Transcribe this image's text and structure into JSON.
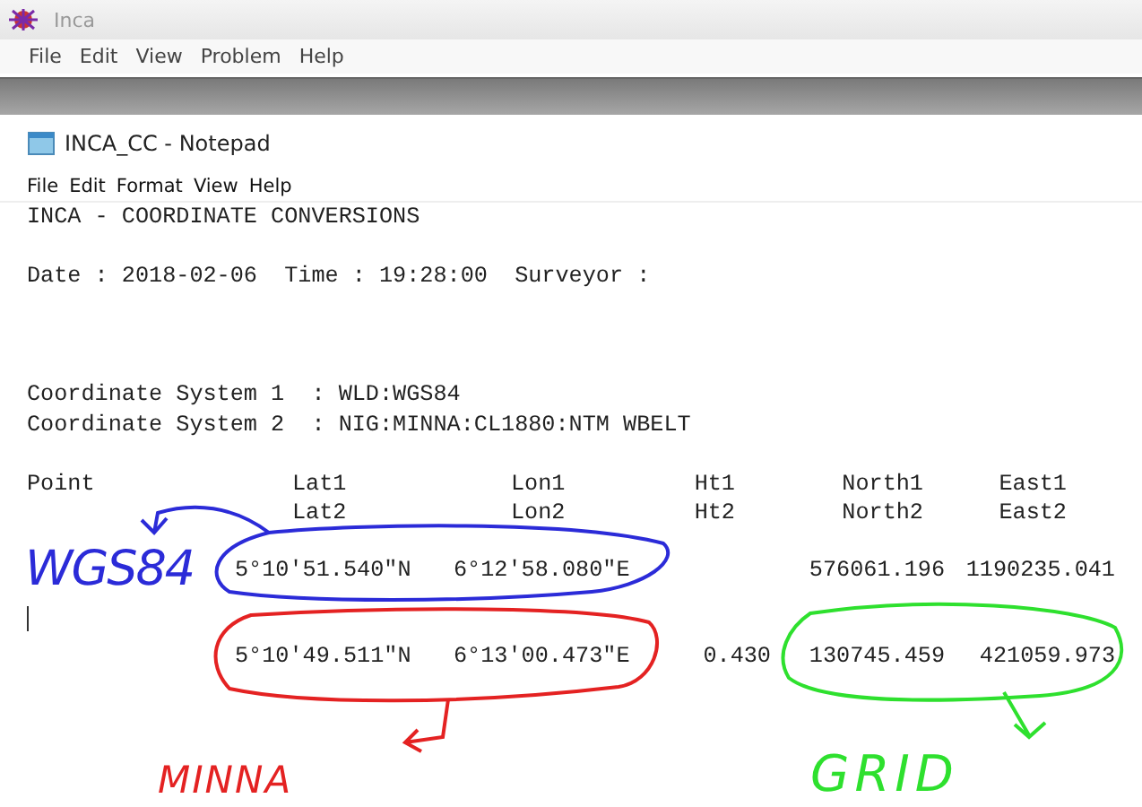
{
  "app_window": {
    "title": "Inca",
    "menu": [
      "File",
      "Edit",
      "View",
      "Problem",
      "Help"
    ]
  },
  "notepad": {
    "title": "INCA_CC - Notepad",
    "menu": [
      "File",
      "Edit",
      "Format",
      "View",
      "Help"
    ],
    "heading": "INCA - COORDINATE CONVERSIONS",
    "date_line": "Date : 2018-02-06  Time : 19:28:00  Surveyor :",
    "systems": [
      "Coordinate System 1  : WLD:WGS84",
      "Coordinate System 2  : NIG:MINNA:CL1880:NTM WBELT"
    ],
    "columns": [
      {
        "top": "Point"
      },
      {
        "top": "Lat1",
        "bottom": "Lat2"
      },
      {
        "top": "Lon1",
        "bottom": "Lon2"
      },
      {
        "top": "Ht1",
        "bottom": "Ht2"
      },
      {
        "top": "North1",
        "bottom": "North2"
      },
      {
        "top": "East1",
        "bottom": "East2"
      }
    ],
    "rows": [
      {
        "lat": "5°10'51.540\"N",
        "lon": "6°12'58.080\"E",
        "north": "576061.196",
        "east": "1190235.041"
      },
      {
        "lat": "5°10'49.511\"N",
        "lon": "6°13'00.473\"E",
        "ht": "0.430",
        "north": "130745.459",
        "east": "421059.973"
      }
    ]
  },
  "annotations": [
    {
      "label": "WGS84",
      "color": "#2b2bd8"
    },
    {
      "label": "MINNA",
      "color": "#e42222"
    },
    {
      "label": "GRID",
      "color": "#2ee02e"
    }
  ]
}
